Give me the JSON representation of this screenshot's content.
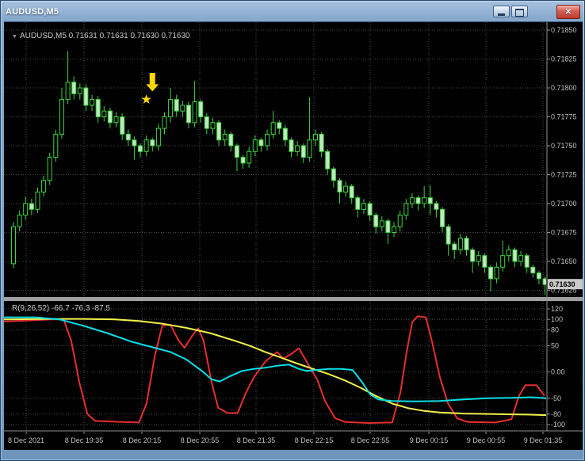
{
  "window": {
    "title": "AUDUSD,M5",
    "controls": {
      "close_glyph": "✕"
    }
  },
  "chart": {
    "marker": "▼",
    "symbol_label": "AUDUSD,M5",
    "ohlc_label": "0.71631 0.71631 0.71630 0.71630",
    "current_price": "0.71630",
    "price_scale": [
      "0.71850",
      "0.71825",
      "0.71800",
      "0.71775",
      "0.71750",
      "0.71725",
      "0.71700",
      "0.71675",
      "0.71650",
      "0.71625"
    ],
    "time_axis": [
      "8 Dec 2021",
      "8 Dec 19:35",
      "8 Dec 20:15",
      "8 Dec 20:55",
      "8 Dec 21:35",
      "8 Dec 22:15",
      "8 Dec 22:55",
      "9 Dec 00:15",
      "9 Dec 00:55",
      "9 Dec 01:35"
    ]
  },
  "indicator": {
    "label": "R(9,26,52)",
    "values": "-66.7 -76.3 -87.5",
    "scale": [
      "120",
      "100",
      "80",
      "50",
      "0.00",
      "-50",
      "-80",
      "-100"
    ]
  },
  "chart_data": {
    "type": "candlestick",
    "symbol": "AUDUSD",
    "timeframe": "M5",
    "price_scale_divisor": 100000,
    "price_axis_ticks": [
      0.7185,
      0.71825,
      0.718,
      0.71775,
      0.7175,
      0.71725,
      0.717,
      0.71675,
      0.7165,
      0.71625
    ],
    "current_close": 0.7163,
    "candles": [
      [
        71648,
        71684,
        71644,
        71680
      ],
      [
        71680,
        71694,
        71676,
        71690
      ],
      [
        71690,
        71706,
        71686,
        71700
      ],
      [
        71700,
        71704,
        71690,
        71695
      ],
      [
        71695,
        71714,
        71692,
        71710
      ],
      [
        71710,
        71724,
        71706,
        71720
      ],
      [
        71720,
        71744,
        71716,
        71740
      ],
      [
        71740,
        71764,
        71736,
        71760
      ],
      [
        71760,
        71800,
        71756,
        71790
      ],
      [
        71790,
        71832,
        71786,
        71805
      ],
      [
        71805,
        71810,
        71790,
        71795
      ],
      [
        71795,
        71804,
        71790,
        71800
      ],
      [
        71800,
        71803,
        71780,
        71785
      ],
      [
        71785,
        71794,
        71780,
        71790
      ],
      [
        71790,
        71793,
        71770,
        71775
      ],
      [
        71775,
        71784,
        71771,
        71780
      ],
      [
        71780,
        71783,
        71765,
        71770
      ],
      [
        71770,
        71779,
        71766,
        71775
      ],
      [
        71775,
        71778,
        71755,
        71760
      ],
      [
        71760,
        71764,
        71750,
        71755
      ],
      [
        71755,
        71758,
        71738,
        71750
      ],
      [
        71750,
        71752,
        71740,
        71745
      ],
      [
        71745,
        71759,
        71741,
        71755
      ],
      [
        71755,
        71757,
        71745,
        71750
      ],
      [
        71750,
        71769,
        71746,
        71765
      ],
      [
        71765,
        71779,
        71760,
        71775
      ],
      [
        71775,
        71800,
        71770,
        71790
      ],
      [
        71790,
        71794,
        71775,
        71780
      ],
      [
        71780,
        71789,
        71775,
        71785
      ],
      [
        71785,
        71788,
        71765,
        71770
      ],
      [
        71770,
        71806,
        71766,
        71788
      ],
      [
        71788,
        71790,
        71770,
        71775
      ],
      [
        71775,
        71778,
        71760,
        71765
      ],
      [
        71765,
        71774,
        71760,
        71770
      ],
      [
        71770,
        71772,
        71750,
        71755
      ],
      [
        71755,
        71764,
        71750,
        71760
      ],
      [
        71760,
        71762,
        71745,
        71750
      ],
      [
        71750,
        71752,
        71728,
        71740
      ],
      [
        71740,
        71742,
        71730,
        71735
      ],
      [
        71735,
        71749,
        71731,
        71745
      ],
      [
        71745,
        71759,
        71741,
        71755
      ],
      [
        71755,
        71757,
        71745,
        71750
      ],
      [
        71750,
        71764,
        71746,
        71760
      ],
      [
        71760,
        71780,
        71756,
        71770
      ],
      [
        71770,
        71772,
        71760,
        71765
      ],
      [
        71765,
        71768,
        71750,
        71755
      ],
      [
        71755,
        71757,
        71740,
        71745
      ],
      [
        71745,
        71754,
        71741,
        71750
      ],
      [
        71750,
        71752,
        71735,
        71740
      ],
      [
        71740,
        71792,
        71736,
        71755
      ],
      [
        71755,
        71764,
        71750,
        71760
      ],
      [
        71760,
        71762,
        71740,
        71745
      ],
      [
        71745,
        71747,
        71725,
        71730
      ],
      [
        71730,
        71732,
        71714,
        71720
      ],
      [
        71720,
        71722,
        71700,
        71710
      ],
      [
        71710,
        71719,
        71706,
        71715
      ],
      [
        71715,
        71717,
        71700,
        71705
      ],
      [
        71705,
        71707,
        71688,
        71695
      ],
      [
        71695,
        71704,
        71691,
        71700
      ],
      [
        71700,
        71702,
        71685,
        71690
      ],
      [
        71690,
        71692,
        71674,
        71680
      ],
      [
        71680,
        71689,
        71676,
        71685
      ],
      [
        71685,
        71687,
        71665,
        71675
      ],
      [
        71675,
        71684,
        71671,
        71680
      ],
      [
        71680,
        71694,
        71676,
        71690
      ],
      [
        71690,
        71704,
        71686,
        71700
      ],
      [
        71700,
        71709,
        71696,
        71705
      ],
      [
        71705,
        71707,
        71694,
        71700
      ],
      [
        71700,
        71715,
        71696,
        71705
      ],
      [
        71705,
        71716,
        71690,
        71700
      ],
      [
        71700,
        71702,
        71688,
        71695
      ],
      [
        71695,
        71697,
        71675,
        71680
      ],
      [
        71680,
        71682,
        71655,
        71665
      ],
      [
        71665,
        71667,
        71652,
        71660
      ],
      [
        71660,
        71674,
        71656,
        71670
      ],
      [
        71670,
        71672,
        71655,
        71660
      ],
      [
        71660,
        71662,
        71640,
        71650
      ],
      [
        71650,
        71659,
        71646,
        71655
      ],
      [
        71655,
        71657,
        71640,
        71645
      ],
      [
        71645,
        71647,
        71624,
        71635
      ],
      [
        71635,
        71649,
        71631,
        71645
      ],
      [
        71645,
        71668,
        71641,
        71655
      ],
      [
        71655,
        71664,
        71650,
        71660
      ],
      [
        71660,
        71662,
        71645,
        71650
      ],
      [
        71650,
        71659,
        71646,
        71655
      ],
      [
        71655,
        71657,
        71640,
        71645
      ],
      [
        71645,
        71647,
        71636,
        71640
      ],
      [
        71640,
        71642,
        71630,
        71635
      ],
      [
        71635,
        71637,
        71621,
        71630
      ]
    ],
    "indicator_pane": {
      "name": "R(9,26,52)",
      "current_values": [
        -66.7,
        -76.3,
        -87.5
      ],
      "range": [
        -112,
        135
      ],
      "levels": [
        120,
        100,
        80,
        50,
        0,
        -50,
        -80,
        -100
      ],
      "series": [
        {
          "name": "red",
          "color": "#e62e2e",
          "width": 2,
          "points": [
            [
              0,
              96
            ],
            [
              0.044,
              98
            ],
            [
              0.088,
              100
            ],
            [
              0.11,
              100
            ],
            [
              0.124,
              60
            ],
            [
              0.139,
              -20
            ],
            [
              0.154,
              -80
            ],
            [
              0.168,
              -93
            ],
            [
              0.219,
              -95
            ],
            [
              0.249,
              -96
            ],
            [
              0.263,
              -60
            ],
            [
              0.278,
              30
            ],
            [
              0.292,
              88
            ],
            [
              0.307,
              90
            ],
            [
              0.322,
              60
            ],
            [
              0.333,
              46
            ],
            [
              0.348,
              70
            ],
            [
              0.358,
              83
            ],
            [
              0.368,
              60
            ],
            [
              0.383,
              -20
            ],
            [
              0.395,
              -68
            ],
            [
              0.412,
              -78
            ],
            [
              0.431,
              -78
            ],
            [
              0.446,
              -40
            ],
            [
              0.461,
              -10
            ],
            [
              0.482,
              20
            ],
            [
              0.504,
              38
            ],
            [
              0.515,
              25
            ],
            [
              0.526,
              32
            ],
            [
              0.544,
              45
            ],
            [
              0.558,
              20
            ],
            [
              0.578,
              -15
            ],
            [
              0.592,
              -55
            ],
            [
              0.611,
              -88
            ],
            [
              0.629,
              -95
            ],
            [
              0.673,
              -97
            ],
            [
              0.716,
              -96
            ],
            [
              0.731,
              -40
            ],
            [
              0.743,
              40
            ],
            [
              0.753,
              95
            ],
            [
              0.763,
              106
            ],
            [
              0.778,
              104
            ],
            [
              0.789,
              60
            ],
            [
              0.804,
              -10
            ],
            [
              0.819,
              -60
            ],
            [
              0.836,
              -88
            ],
            [
              0.855,
              -95
            ],
            [
              0.906,
              -96
            ],
            [
              0.936,
              -90
            ],
            [
              0.95,
              -45
            ],
            [
              0.962,
              -25
            ],
            [
              0.982,
              -25
            ],
            [
              0.997,
              -45
            ]
          ]
        },
        {
          "name": "yellow",
          "color": "#f2f24a",
          "width": 2,
          "points": [
            [
              0,
              100
            ],
            [
              0.088,
              101
            ],
            [
              0.146,
              101
            ],
            [
              0.205,
              100
            ],
            [
              0.249,
              97
            ],
            [
              0.292,
              92
            ],
            [
              0.336,
              84
            ],
            [
              0.38,
              74
            ],
            [
              0.424,
              60
            ],
            [
              0.453,
              50
            ],
            [
              0.482,
              38
            ],
            [
              0.512,
              27
            ],
            [
              0.541,
              16
            ],
            [
              0.57,
              6
            ],
            [
              0.599,
              -4
            ],
            [
              0.629,
              -16
            ],
            [
              0.658,
              -30
            ],
            [
              0.687,
              -46
            ],
            [
              0.716,
              -60
            ],
            [
              0.746,
              -69
            ],
            [
              0.775,
              -74
            ],
            [
              0.804,
              -77
            ],
            [
              0.848,
              -79
            ],
            [
              0.906,
              -80
            ],
            [
              0.965,
              -81
            ],
            [
              1,
              -82
            ]
          ]
        },
        {
          "name": "cyan",
          "color": "#00e0e8",
          "width": 2,
          "points": [
            [
              0,
              104
            ],
            [
              0.058,
              104
            ],
            [
              0.102,
              100
            ],
            [
              0.146,
              88
            ],
            [
              0.19,
              74
            ],
            [
              0.234,
              58
            ],
            [
              0.278,
              46
            ],
            [
              0.307,
              38
            ],
            [
              0.336,
              24
            ],
            [
              0.365,
              2
            ],
            [
              0.383,
              -14
            ],
            [
              0.398,
              -18
            ],
            [
              0.417,
              -8
            ],
            [
              0.439,
              2
            ],
            [
              0.461,
              6
            ],
            [
              0.482,
              8
            ],
            [
              0.504,
              12
            ],
            [
              0.526,
              14
            ],
            [
              0.544,
              6
            ],
            [
              0.558,
              2
            ],
            [
              0.578,
              4
            ],
            [
              0.599,
              6
            ],
            [
              0.621,
              6
            ],
            [
              0.643,
              4
            ],
            [
              0.661,
              -20
            ],
            [
              0.675,
              -42
            ],
            [
              0.69,
              -52
            ],
            [
              0.716,
              -55
            ],
            [
              0.76,
              -56
            ],
            [
              0.804,
              -55
            ],
            [
              0.848,
              -52
            ],
            [
              0.892,
              -50
            ],
            [
              0.936,
              -49
            ],
            [
              0.972,
              -48
            ],
            [
              1,
              -50
            ]
          ]
        }
      ]
    },
    "annotations": [
      {
        "type": "arrow-down",
        "color": "#ffd800",
        "candle_index": 23,
        "tip_price": 71797,
        "top_price": 71813
      },
      {
        "type": "star",
        "color": "#ffd800",
        "candle_index": 22,
        "price": 71790
      }
    ],
    "colors": {
      "background": "#000000",
      "grid": "#4a4a4a",
      "candle_border": "#3fd43f",
      "bull_fill": "#000000",
      "bear_fill": "#bfe8bf",
      "axis_text": "#c0c0c0",
      "current_price_bg": "#c9c9c9",
      "current_price_text": "#000000",
      "splitter": "#a0a0a0",
      "axis_line": "#909090"
    }
  }
}
